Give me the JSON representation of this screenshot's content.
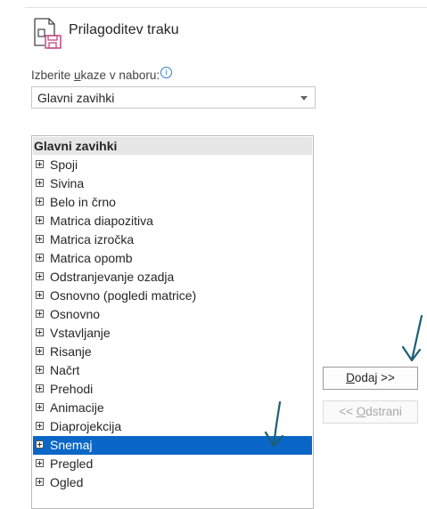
{
  "header": {
    "title": "Prilagoditev traku",
    "icon": "customize-ribbon-icon"
  },
  "commands": {
    "label_pre": "Izberite ",
    "label_ul": "u",
    "label_post": "kaze v naboru:",
    "info_glyph": "i",
    "selected": "Glavni zavihki"
  },
  "list": {
    "header": "Glavni zavihki",
    "items": [
      {
        "label": "Spoji"
      },
      {
        "label": "Sivina"
      },
      {
        "label": "Belo in črno"
      },
      {
        "label": "Matrica diapozitiva"
      },
      {
        "label": "Matrica izročka"
      },
      {
        "label": "Matrica opomb"
      },
      {
        "label": "Odstranjevanje ozadja"
      },
      {
        "label": "Osnovno (pogledi matrice)"
      },
      {
        "label": "Osnovno"
      },
      {
        "label": "Vstavljanje"
      },
      {
        "label": "Risanje"
      },
      {
        "label": "Načrt"
      },
      {
        "label": "Prehodi"
      },
      {
        "label": "Animacije"
      },
      {
        "label": "Diaprojekcija"
      },
      {
        "label": "Snemaj",
        "selected": true
      },
      {
        "label": "Pregled"
      },
      {
        "label": "Ogled"
      }
    ]
  },
  "buttons": {
    "add_ul": "D",
    "add_rest": "odaj >>",
    "remove_pre": "<< ",
    "remove_ul": "O",
    "remove_rest": "dstrani"
  },
  "colors": {
    "selection": "#0a66c7",
    "annotation": "#1c5f73"
  }
}
